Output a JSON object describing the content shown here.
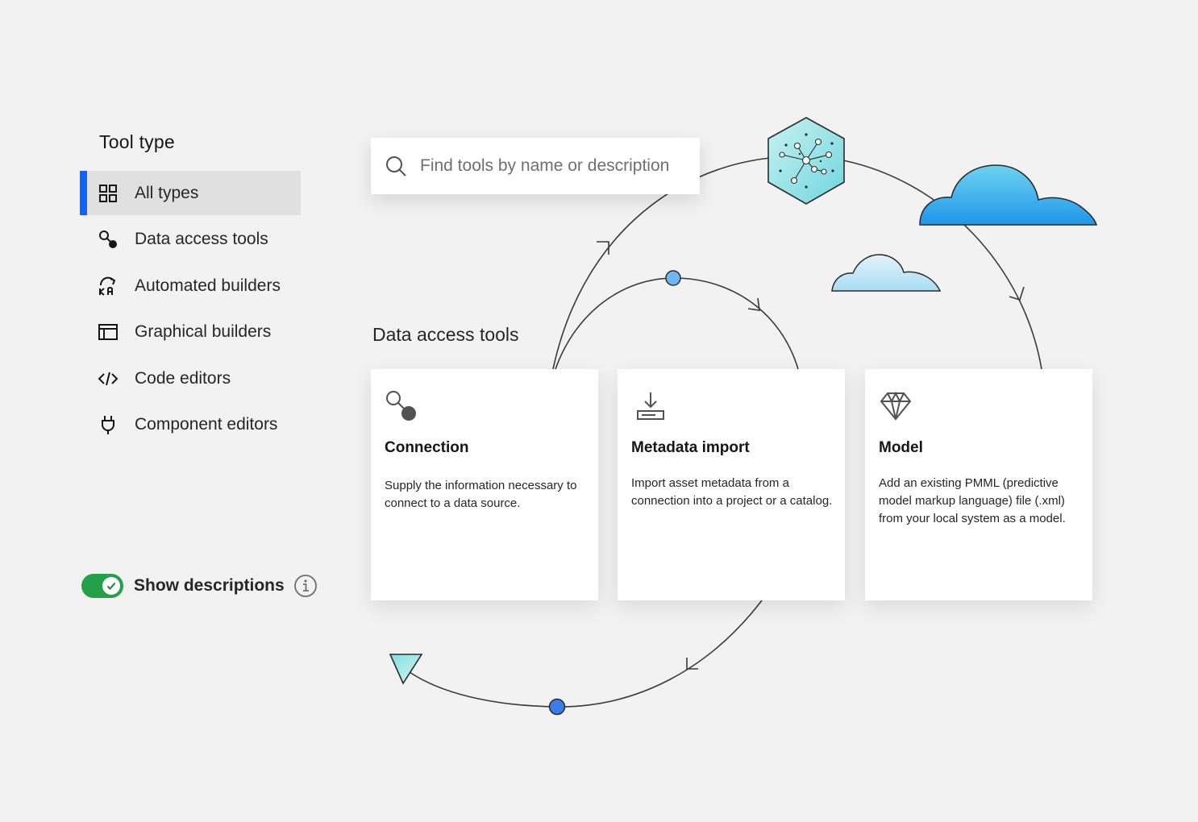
{
  "sidebar": {
    "title": "Tool type",
    "items": [
      {
        "label": "All types",
        "icon": "grid-icon",
        "active": true
      },
      {
        "label": "Data access tools",
        "icon": "connection-icon",
        "active": false
      },
      {
        "label": "Automated builders",
        "icon": "automated-builder-icon",
        "active": false
      },
      {
        "label": "Graphical builders",
        "icon": "graphical-builder-icon",
        "active": false
      },
      {
        "label": "Code editors",
        "icon": "code-icon",
        "active": false
      },
      {
        "label": "Component editors",
        "icon": "plug-icon",
        "active": false
      }
    ]
  },
  "toggle": {
    "label": "Show descriptions",
    "on": true,
    "color": "#24a148"
  },
  "search": {
    "placeholder": "Find tools by name or description"
  },
  "section": {
    "title": "Data access tools"
  },
  "cards": [
    {
      "title": "Connection",
      "description": "Supply the information necessary to connect to a data source.",
      "icon": "connection-icon"
    },
    {
      "title": "Metadata import",
      "description": "Import asset metadata from a connection into a project or a catalog.",
      "icon": "download-icon"
    },
    {
      "title": "Model",
      "description": "Add an existing PMML (predictive model markup language) file (.xml) from your local system as a model.",
      "icon": "diamond-icon"
    }
  ],
  "colors": {
    "accent": "#0f62fe",
    "background": "#f2f2f2",
    "cloud": "#29a9e8"
  }
}
